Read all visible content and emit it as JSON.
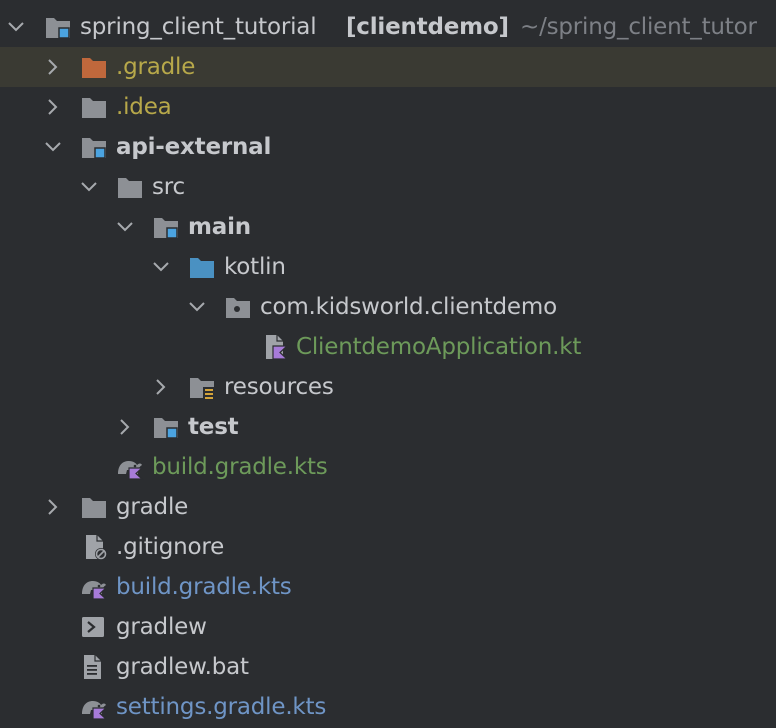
{
  "project_tree": {
    "root": {
      "name": "spring_client_tutorial",
      "module": "[clientdemo]",
      "path": "~/spring_client_tutor"
    },
    "items": [
      {
        "label": ".gradle",
        "icon": "folder-excluded-icon"
      },
      {
        "label": ".idea",
        "icon": "folder-icon"
      },
      {
        "label": "api-external",
        "icon": "module-folder-icon"
      },
      {
        "label": "src",
        "icon": "folder-icon"
      },
      {
        "label": "main",
        "icon": "source-root-folder-icon"
      },
      {
        "label": "kotlin",
        "icon": "source-folder-icon"
      },
      {
        "label": "com.kidsworld.clientdemo",
        "icon": "package-icon"
      },
      {
        "label": "ClientdemoApplication.kt",
        "icon": "kotlin-file-icon"
      },
      {
        "label": "resources",
        "icon": "resources-folder-icon"
      },
      {
        "label": "test",
        "icon": "test-folder-icon"
      },
      {
        "label": "build.gradle.kts",
        "icon": "gradle-kotlin-icon"
      },
      {
        "label": "gradle",
        "icon": "folder-icon"
      },
      {
        "label": ".gitignore",
        "icon": "ignored-file-icon"
      },
      {
        "label": "build.gradle.kts",
        "icon": "gradle-kotlin-icon"
      },
      {
        "label": "gradlew",
        "icon": "shell-script-icon"
      },
      {
        "label": "gradlew.bat",
        "icon": "text-file-icon"
      },
      {
        "label": "settings.gradle.kts",
        "icon": "gradle-kotlin-icon"
      }
    ]
  },
  "colors": {
    "background": "#2b2d30",
    "selected_row": "#3a3a33",
    "text": "#c6c8cc",
    "modified_green": "#6d9a5a",
    "excluded_yellow": "#b7a84a",
    "changed_blue": "#6f95c6",
    "path_gray": "#7d8086"
  }
}
